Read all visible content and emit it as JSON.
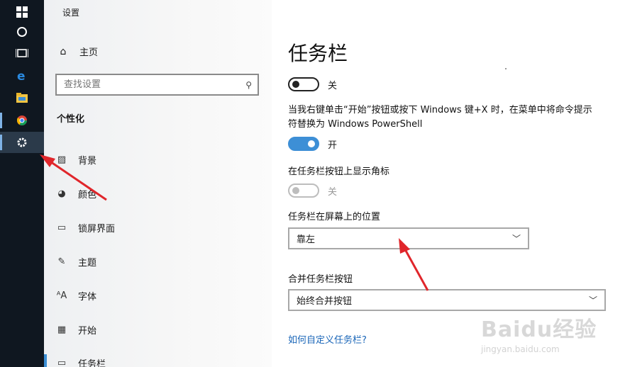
{
  "taskbar": {
    "icons": [
      "windows-start-icon",
      "cortana-icon",
      "task-view-icon",
      "edge-icon",
      "file-explorer-icon",
      "chrome-icon",
      "settings-gear-icon"
    ]
  },
  "nav": {
    "title": "设置",
    "home_label": "主页",
    "search_placeholder": "查找设置",
    "section_label": "个性化",
    "items": [
      {
        "label": "背景",
        "icon": "image-icon"
      },
      {
        "label": "颜色",
        "icon": "palette-icon"
      },
      {
        "label": "锁屏界面",
        "icon": "lock-screen-icon"
      },
      {
        "label": "主题",
        "icon": "theme-icon"
      },
      {
        "label": "字体",
        "icon": "font-icon"
      },
      {
        "label": "开始",
        "icon": "start-icon"
      },
      {
        "label": "任务栏",
        "icon": "taskbar-icon"
      }
    ]
  },
  "main": {
    "title": "任务栏",
    "toggle1_label": "关",
    "description": "当我右键单击“开始”按钮或按下 Windows 键+X 时，在菜单中将命令提示符替换为 Windows PowerShell",
    "toggle2_label": "开",
    "badges_label": "在任务栏按钮上显示角标",
    "toggle3_label": "关",
    "position_label": "任务栏在屏幕上的位置",
    "position_value": "靠左",
    "combine_label": "合并任务栏按钮",
    "combine_value": "始终合并按钮",
    "help_link": "如何自定义任务栏?"
  },
  "watermark": {
    "logo": "Baidu经验",
    "url": "jingyan.baidu.com"
  },
  "colors": {
    "accent": "#3d8fd6",
    "taskbar_bg": "#0f1720",
    "link": "#1a66b8",
    "arrow": "#e0262b"
  }
}
